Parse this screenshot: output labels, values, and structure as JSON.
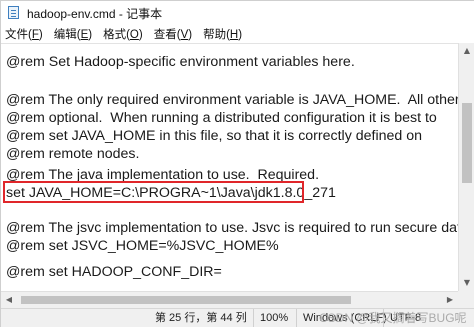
{
  "window": {
    "title": "hadoop-env.cmd - 记事本"
  },
  "menu": [
    {
      "label": "文件(",
      "mnemonic": "F",
      "suffix": ")"
    },
    {
      "label": "编辑(",
      "mnemonic": "E",
      "suffix": ")"
    },
    {
      "label": "格式(",
      "mnemonic": "O",
      "suffix": ")"
    },
    {
      "label": "查看(",
      "mnemonic": "V",
      "suffix": ")"
    },
    {
      "label": "帮助(",
      "mnemonic": "H",
      "suffix": ")"
    }
  ],
  "editor": {
    "lines": [
      "@rem Set Hadoop-specific environment variables here.",
      "",
      "@rem The only required environment variable is JAVA_HOME.  All others are",
      "@rem optional.  When running a distributed configuration it is best to",
      "@rem set JAVA_HOME in this file, so that it is correctly defined on",
      "@rem remote nodes.",
      "",
      "@rem The java implementation to use.  Required.",
      "set JAVA_HOME=C:\\PROGRA~1\\Java\\jdk1.8.0_271",
      "",
      "@rem The jsvc implementation to use. Jsvc is required to run secure datanodes.",
      "@rem set JSVC_HOME=%JSVC_HOME%",
      "",
      "@rem set HADOOP_CONF_DIR="
    ],
    "highlighted_line_index": 8
  },
  "statusbar": {
    "position": "第 25 行，第 44 列",
    "zoom": "100%",
    "line_ending": "Windows (CRLF)",
    "encoding": "UTF-8",
    "watermark": "CSDN @我又搁着写BUG呢"
  },
  "colors": {
    "highlight_border": "#e0262a",
    "statusbar_bg": "#f0f0f0"
  },
  "icons": [
    "notepad-app-icon",
    "scroll-up-arrow",
    "scroll-down-arrow",
    "scroll-left-arrow",
    "scroll-right-arrow"
  ]
}
